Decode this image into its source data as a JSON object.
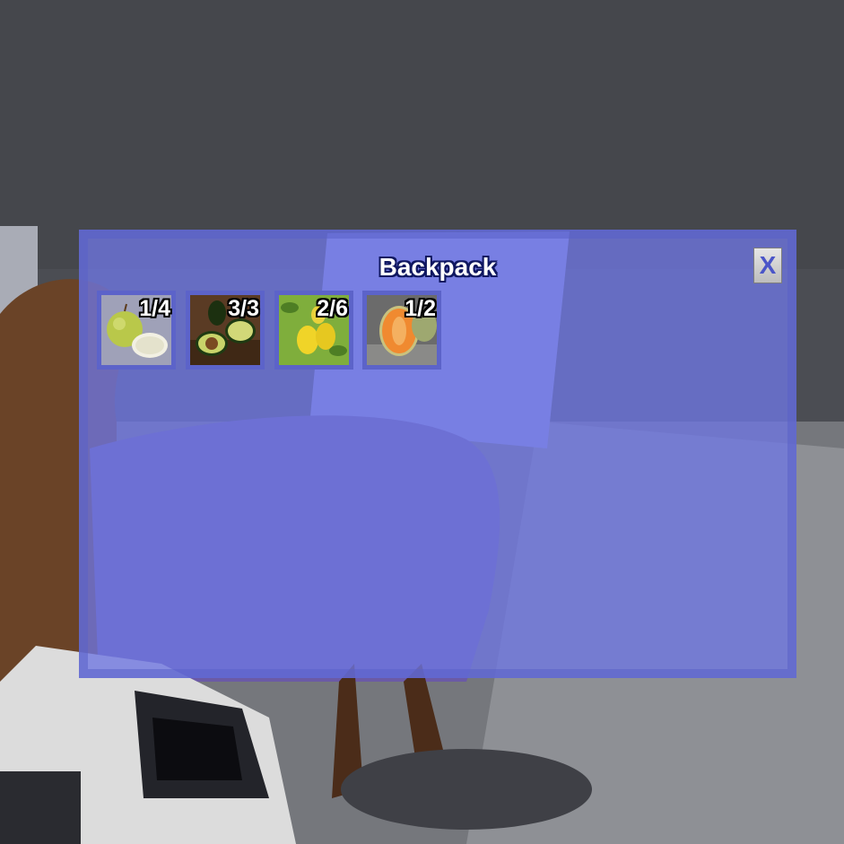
{
  "backpack": {
    "title": "Backpack",
    "close_label": "X",
    "slots": [
      {
        "item": "green apple",
        "count": "1/4"
      },
      {
        "item": "avocado",
        "count": "3/3"
      },
      {
        "item": "lemons",
        "count": "2/6"
      },
      {
        "item": "cantaloupe melon",
        "count": "1/2"
      }
    ]
  },
  "colors": {
    "panel": "#6e76e1",
    "slot": "#5c63c9",
    "title_outline": "#0f1760",
    "close_text": "#4a55c8"
  }
}
